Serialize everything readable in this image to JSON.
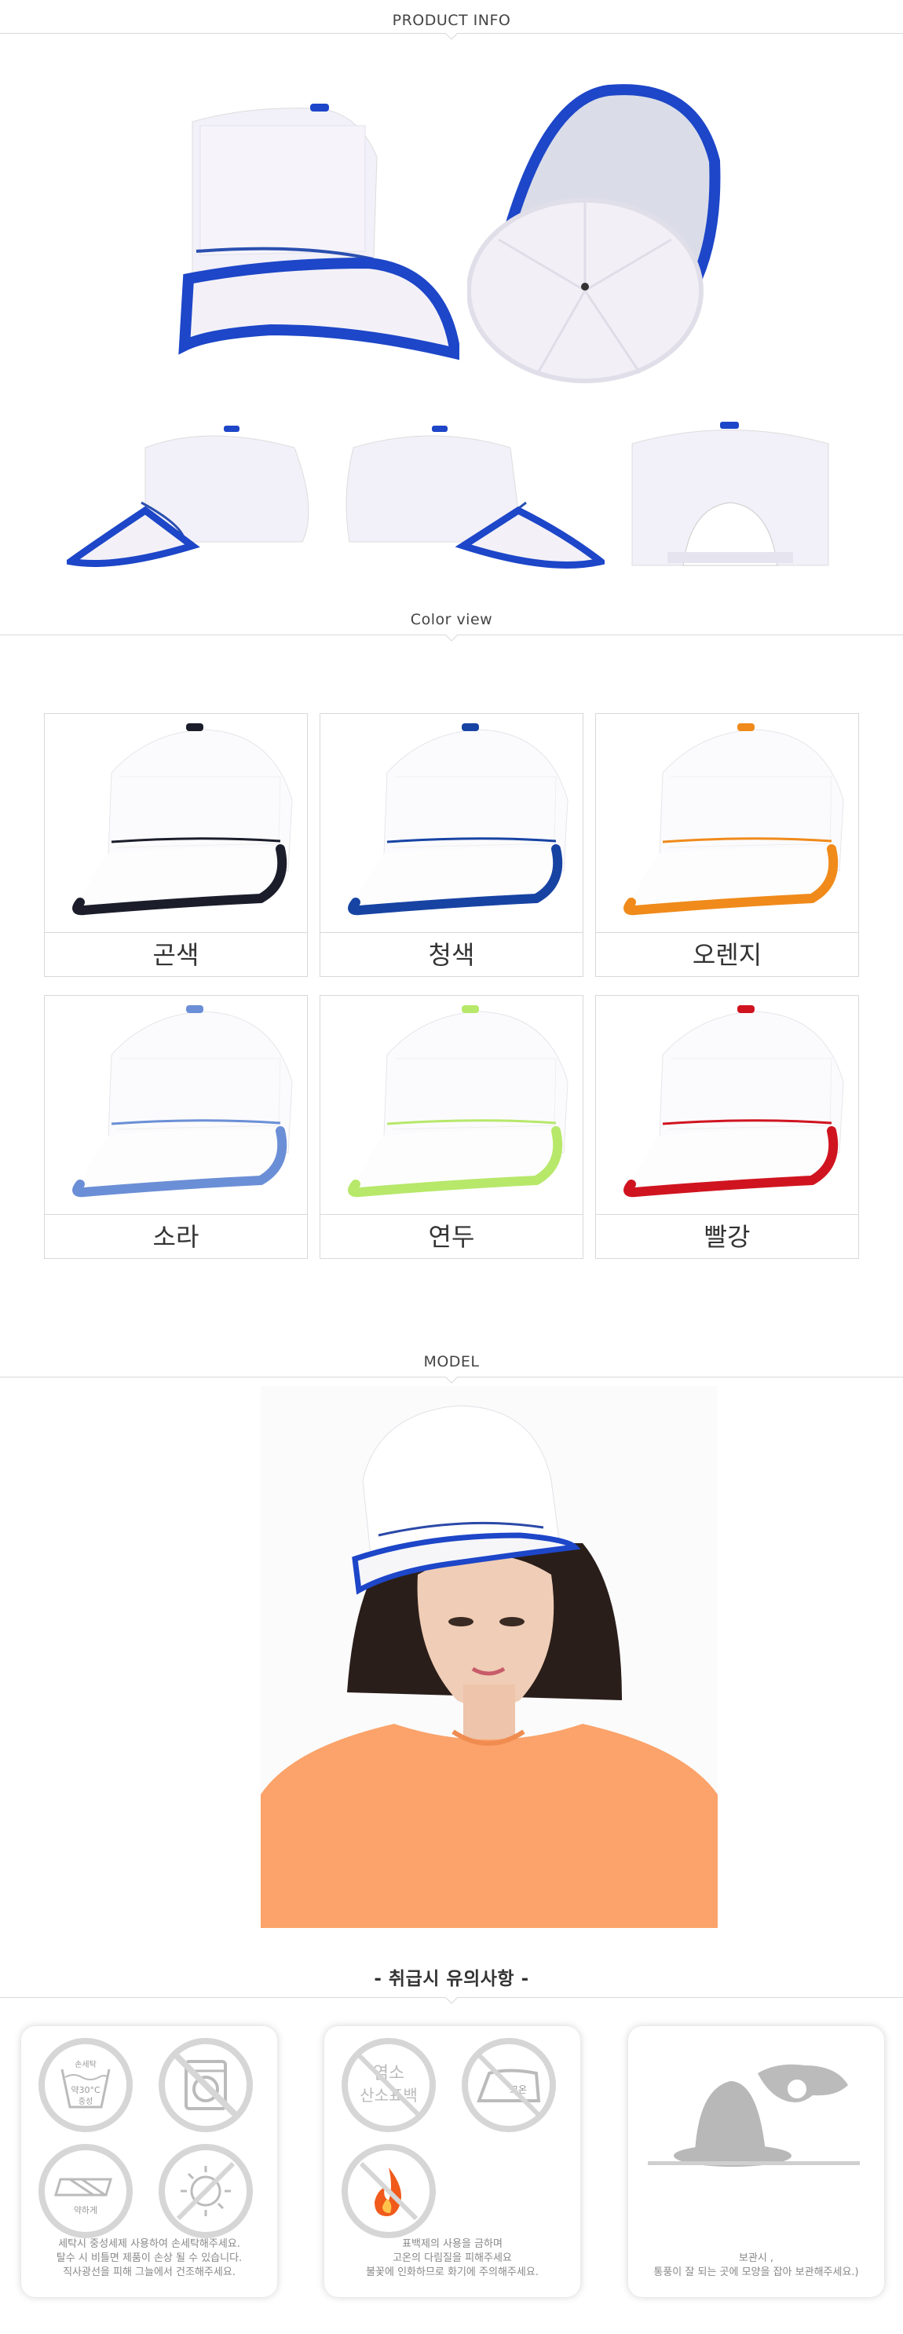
{
  "sections": {
    "product_info": "PRODUCT INFO",
    "color_view": "Color view",
    "model": "MODEL",
    "care": "- 취급시 유의사항 -"
  },
  "colors": [
    {
      "name": "곤색",
      "hex": "#1b1d2b"
    },
    {
      "name": "청색",
      "hex": "#1743a3"
    },
    {
      "name": "오렌지",
      "hex": "#f08a1a"
    },
    {
      "name": "소라",
      "hex": "#6b8fd6"
    },
    {
      "name": "연두",
      "hex": "#b7e86a"
    },
    {
      "name": "빨강",
      "hex": "#d0141f"
    }
  ],
  "care": {
    "wash_label_1": "손세탁",
    "wash_label_2": "약30°C",
    "wash_label_3": "중성",
    "wring_label": "약하게",
    "bleach_label_1": "염소",
    "bleach_label_2": "산소표백",
    "iron_label": "고온",
    "card1_text": "세탁시 중성세제 사용하여 손세탁해주세요.\n탈수 시 비틀면 제품이 손상 될 수 있습니다.\n직사광선을 피해 그늘에서 건조해주세요.",
    "card2_text": "표백제의 사용을 금하며\n고온의 다림질을 피해주세요\n불꽃에 인화하므로 화기에 주의해주세요.",
    "card3_text": "보관시 ,\n통풍이 잘 되는 곳에 모양을 잡아 보관해주세요.)"
  }
}
